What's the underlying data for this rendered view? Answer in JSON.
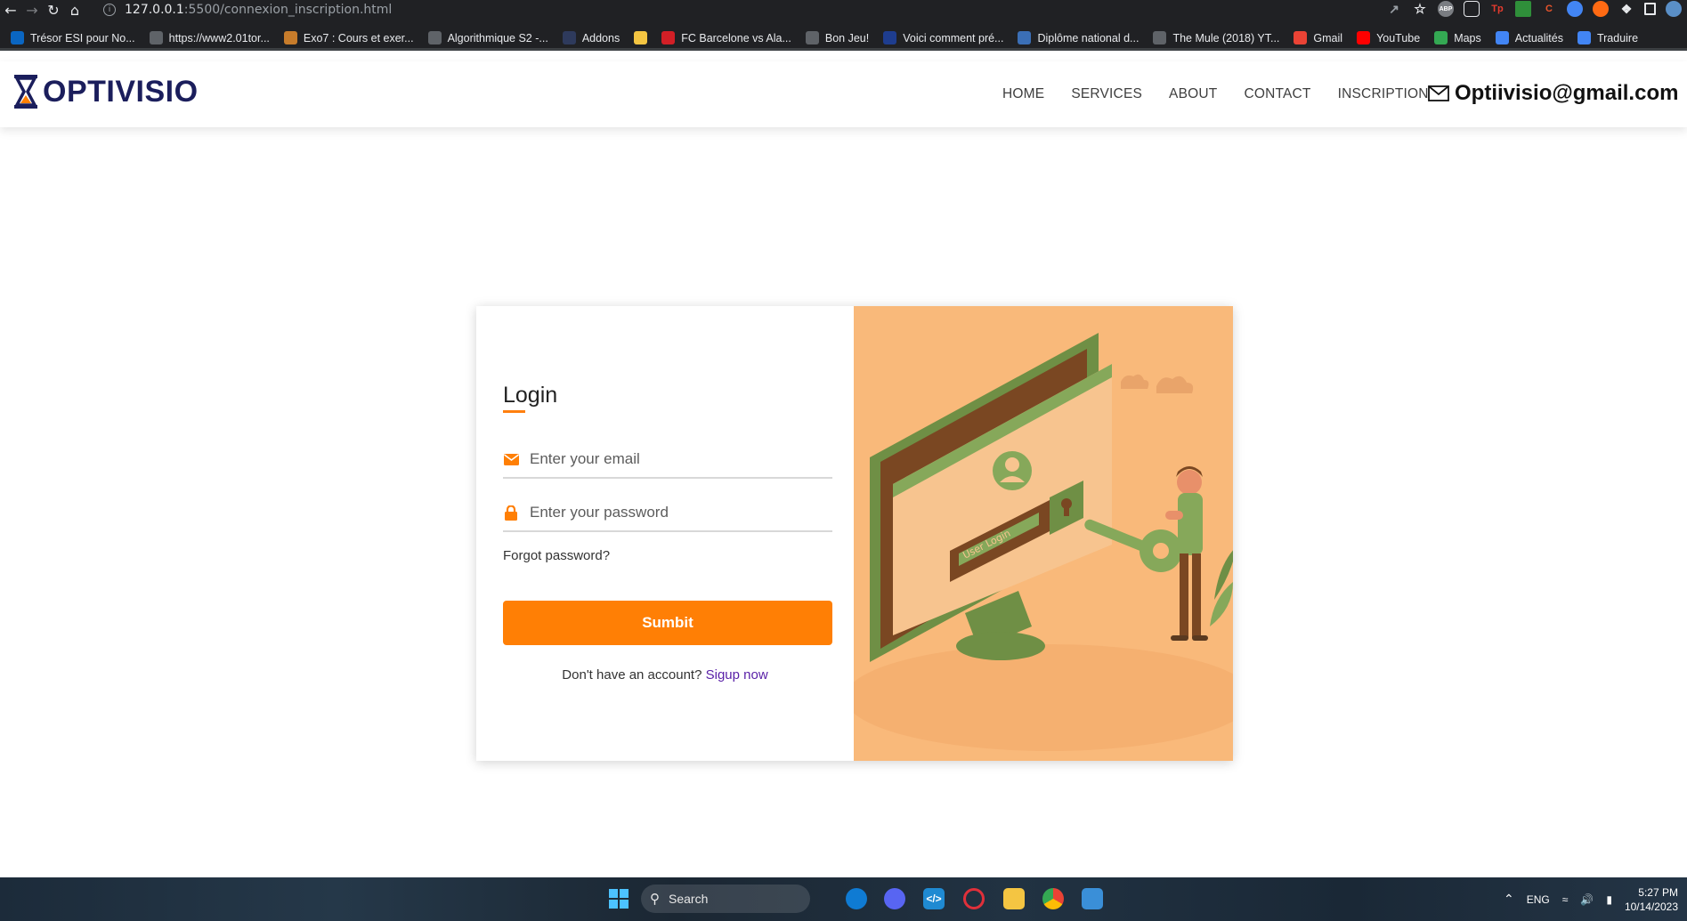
{
  "browser": {
    "url_host": "127.0.0.1",
    "url_path": ":5500/connexion_inscription.html",
    "bookmarks": [
      {
        "label": "Trésor ESI pour No...",
        "icon": "linkedin-icon",
        "color": "#0a66c2"
      },
      {
        "label": "https://www2.01tor...",
        "icon": "globe-icon",
        "color": "#5f6368"
      },
      {
        "label": "Exo7 : Cours et exer...",
        "icon": "grid-icon",
        "color": "#c77c2b"
      },
      {
        "label": "Algorithmique S2 -...",
        "icon": "gear-icon",
        "color": "#5f6368"
      },
      {
        "label": "Addons",
        "icon": "addons-icon",
        "color": "#2e3a5c"
      },
      {
        "label": "",
        "icon": "folder-icon",
        "color": "#f4c542"
      },
      {
        "label": "FC Barcelone vs Ala...",
        "icon": "di-icon",
        "color": "#d21f26"
      },
      {
        "label": "Bon Jeu!",
        "icon": "g-icon",
        "color": "#5f6368"
      },
      {
        "label": "Voici comment pré...",
        "icon": "shield-icon",
        "color": "#1e3d8f"
      },
      {
        "label": "Diplôme national d...",
        "icon": "bars-icon",
        "color": "#3b6fb6"
      },
      {
        "label": "The Mule (2018) YT...",
        "icon": "globe-icon",
        "color": "#5f6368"
      },
      {
        "label": "Gmail",
        "icon": "gmail-icon",
        "color": "#ea4335"
      },
      {
        "label": "YouTube",
        "icon": "youtube-icon",
        "color": "#ff0000"
      },
      {
        "label": "Maps",
        "icon": "maps-icon",
        "color": "#34a853"
      },
      {
        "label": "Actualités",
        "icon": "news-icon",
        "color": "#4285f4"
      },
      {
        "label": "Traduire",
        "icon": "translate-icon",
        "color": "#4285f4"
      }
    ]
  },
  "header": {
    "logo_text": "OPTIVISIO",
    "nav": [
      "HOME",
      "SERVICES",
      "ABOUT",
      "CONTACT",
      "INSCRIPTION"
    ],
    "email": "Optiivisio@gmail.com"
  },
  "login": {
    "title": "Login",
    "email_placeholder": "Enter your email",
    "password_placeholder": "Enter your password",
    "forgot": "Forgot password?",
    "submit": "Sumbit",
    "signup_prompt": "Don't have an account?",
    "signup_link": "Sigup now",
    "art_label": "User Login"
  },
  "taskbar": {
    "search": "Search",
    "lang": "ENG",
    "time": "5:27 PM",
    "date": "10/14/2023"
  },
  "colors": {
    "accent": "#ff7f05",
    "brand": "#1b1e5c",
    "art_bg": "#f9b97a",
    "link": "#5a21a8"
  }
}
